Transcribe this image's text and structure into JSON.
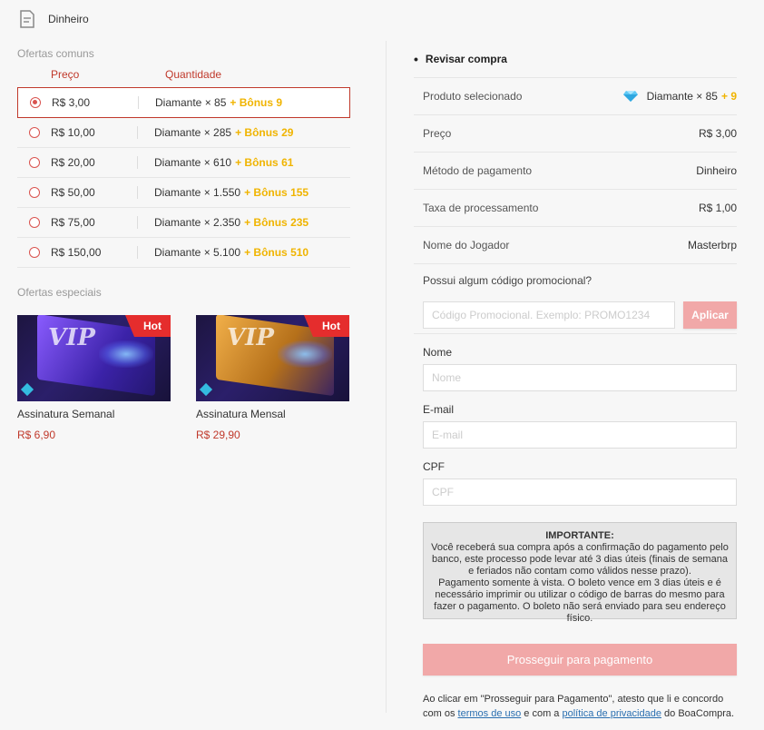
{
  "header": {
    "title": "Dinheiro",
    "icon": "document-icon"
  },
  "offers": {
    "common_label": "Ofertas comuns",
    "col_price": "Preço",
    "col_quantity": "Quantidade",
    "items": [
      {
        "price": "R$ 3,00",
        "qty": "Diamante × 85",
        "bonus": "+ Bônus 9",
        "selected": true
      },
      {
        "price": "R$ 10,00",
        "qty": "Diamante × 285",
        "bonus": "+ Bônus 29",
        "selected": false
      },
      {
        "price": "R$ 20,00",
        "qty": "Diamante × 610",
        "bonus": "+ Bônus 61",
        "selected": false
      },
      {
        "price": "R$ 50,00",
        "qty": "Diamante × 1.550",
        "bonus": "+ Bônus 155",
        "selected": false
      },
      {
        "price": "R$ 75,00",
        "qty": "Diamante × 2.350",
        "bonus": "+ Bônus 235",
        "selected": false
      },
      {
        "price": "R$ 150,00",
        "qty": "Diamante × 5.100",
        "bonus": "+ Bônus 510",
        "selected": false
      }
    ],
    "special_label": "Ofertas especiais",
    "specials": [
      {
        "name": "Assinatura Semanal",
        "price": "R$ 6,90",
        "badge": "Hot",
        "vip": "VIP",
        "theme": "#6a3cff"
      },
      {
        "name": "Assinatura Mensal",
        "price": "R$ 29,90",
        "badge": "Hot",
        "vip": "VIP",
        "theme": "#d08a1c"
      }
    ]
  },
  "review": {
    "bullet": "•",
    "title": "Revisar compra",
    "rows": {
      "product_label": "Produto selecionado",
      "product_value": "Diamante × 85",
      "product_bonus": "+ 9",
      "price_label": "Preço",
      "price_value": "R$ 3,00",
      "method_label": "Método de pagamento",
      "method_value": "Dinheiro",
      "fee_label": "Taxa de processamento",
      "fee_value": "R$ 1,00",
      "player_label": "Nome do Jogador",
      "player_value": "Masterbrp"
    },
    "promo": {
      "question": "Possui algum código promocional?",
      "placeholder": "Código Promocional. Exemplo: PROMO1234",
      "apply": "Aplicar"
    },
    "fields": {
      "name_label": "Nome",
      "name_placeholder": "Nome",
      "email_label": "E-mail",
      "email_placeholder": "E-mail",
      "cpf_label": "CPF",
      "cpf_placeholder": "CPF"
    },
    "important": {
      "title": "IMPORTANTE:",
      "line1": "Você receberá sua compra após a confirmação do pagamento pelo banco, este processo pode levar até 3 dias úteis (finais de semana e feriados não contam como válidos nesse prazo).",
      "line2": "Pagamento somente à vista. O boleto vence em 3 dias úteis e é necessário imprimir ou utilizar o código de barras do mesmo para fazer o pagamento. O boleto não será enviado para seu endereço físico."
    },
    "proceed": "Prosseguir para pagamento",
    "terms": {
      "pre": "Ao clicar em \"Prosseguir para Pagamento\", atesto que li e concordo com os",
      "terms_link": "termos de uso",
      "mid": "e com a",
      "privacy_link": "política de privacidade",
      "post": "do BoaCompra."
    }
  },
  "colors": {
    "accent": "#c0392b",
    "bonus": "#f0b400",
    "button": "#f1a8a8"
  }
}
